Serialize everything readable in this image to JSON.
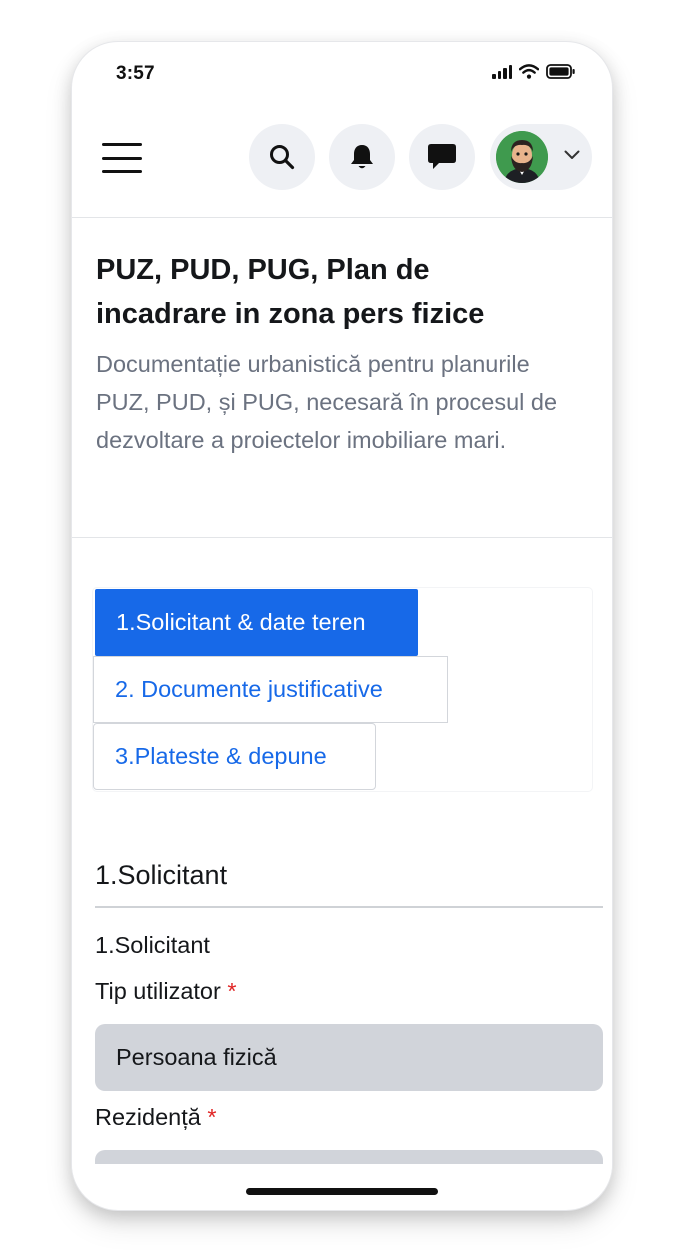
{
  "status_bar": {
    "time": "3:57"
  },
  "header": {
    "icons": [
      "menu-icon",
      "search-icon",
      "bell-icon",
      "chat-icon",
      "avatar",
      "chevron-down-icon"
    ]
  },
  "page": {
    "title": "PUZ, PUD, PUG, Plan de incadrare in zona pers fizice",
    "description": "Documentație urbanistică pentru planurile PUZ, PUD, și PUG, necesară în procesul de dezvoltare a proiectelor imobiliare mari."
  },
  "steps": [
    {
      "label": "1.Solicitant & date teren",
      "active": true
    },
    {
      "label": "2. Documente justificative",
      "active": false
    },
    {
      "label": "3.Plateste & depune",
      "active": false
    }
  ],
  "form": {
    "section_title": "1.Solicitant",
    "subsection_title": "1.Solicitant",
    "fields": [
      {
        "label": "Tip utilizator",
        "required_mark": "*",
        "value": "Persoana fizică"
      },
      {
        "label": "Rezidență",
        "required_mark": "*",
        "value": ""
      }
    ]
  },
  "colors": {
    "accent": "#1769e8",
    "required": "#e02424",
    "select_bg": "#d1d4da",
    "icon_button_bg": "#eef0f4"
  }
}
